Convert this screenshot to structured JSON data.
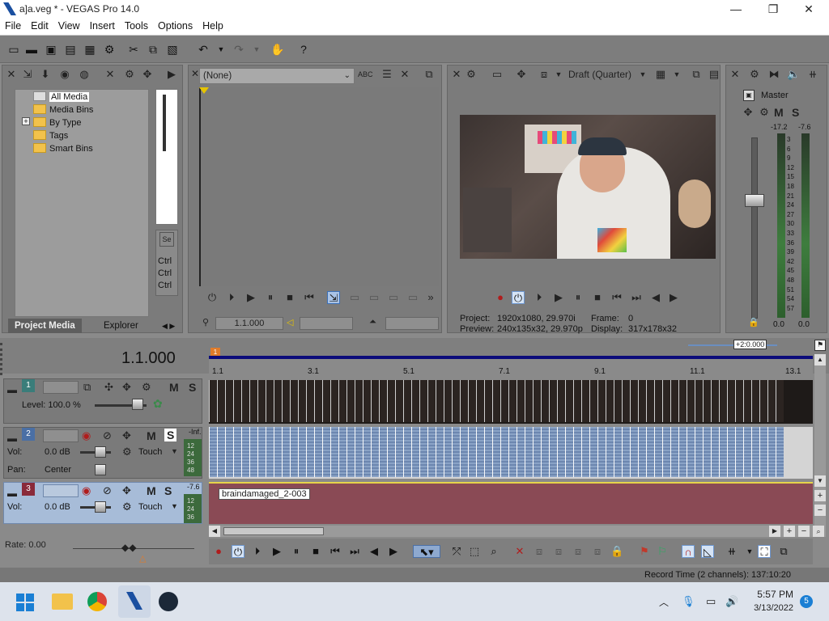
{
  "window": {
    "title": "a]a.veg * - VEGAS Pro 14.0",
    "minimize": "—",
    "maximize": "❐",
    "close": "✕"
  },
  "menu": [
    "File",
    "Edit",
    "View",
    "Insert",
    "Tools",
    "Options",
    "Help"
  ],
  "project_media": {
    "tree": [
      "All Media",
      "Media Bins",
      "By Type",
      "Tags",
      "Smart Bins"
    ],
    "expander": "+",
    "tabs": [
      "Project Media",
      "Explorer"
    ],
    "side_labels": [
      "Ctrl",
      "Ctrl",
      "Ctrl"
    ]
  },
  "trimmer": {
    "selector": "(None)",
    "timecode": "1.1.000"
  },
  "preview": {
    "quality": "Draft (Quarter)",
    "project_label": "Project:",
    "project_value": "1920x1080, 29.970i",
    "preview_label": "Preview:",
    "preview_value": "240x135x32, 29.970p",
    "frame_label": "Frame:",
    "frame_value": "0",
    "display_label": "Display:",
    "display_value": "317x178x32"
  },
  "master": {
    "label": "Master",
    "peak_left": "-17.2",
    "peak_right": "-7.6",
    "scale": [
      "3",
      "6",
      "9",
      "12",
      "15",
      "18",
      "21",
      "24",
      "27",
      "30",
      "33",
      "36",
      "39",
      "42",
      "45",
      "48",
      "51",
      "54",
      "57"
    ],
    "bottom_left": "0.0",
    "bottom_right": "0.0"
  },
  "timeline": {
    "cursor": "1.1.000",
    "loop_badge": "+2:0.000",
    "ruler": [
      "1.1",
      "3.1",
      "5.1",
      "7.1",
      "9.1",
      "11.1",
      "13.1"
    ],
    "tracks": [
      {
        "num": "1",
        "level_label": "Level: 100.0 %"
      },
      {
        "num": "2",
        "vol_label": "Vol:",
        "vol_value": "0.0 dB",
        "pan_label": "Pan:",
        "pan_value": "Center",
        "mode": "Touch",
        "meter_top": "-Inf.",
        "meter_scale": [
          "12",
          "24",
          "36",
          "48"
        ]
      },
      {
        "num": "3",
        "vol_label": "Vol:",
        "vol_value": "0.0 dB",
        "mode": "Touch",
        "meter_top": "-7.6",
        "meter_scale": [
          "12",
          "24",
          "36"
        ],
        "clip_name": "braindamaged_2-003"
      }
    ],
    "rate": "Rate: 0.00",
    "mute": "M",
    "solo": "S"
  },
  "status": {
    "record_time": "Record Time (2 channels): 137:10:20"
  },
  "taskbar": {
    "time": "5:57 PM",
    "date": "3/13/2022",
    "notif_count": "5"
  },
  "colors": {
    "accent": "#1a4fa0",
    "timeline_bar": "#0b0b7a",
    "audio_clip": "#8a4a55",
    "selection": "#4a6fa5"
  }
}
